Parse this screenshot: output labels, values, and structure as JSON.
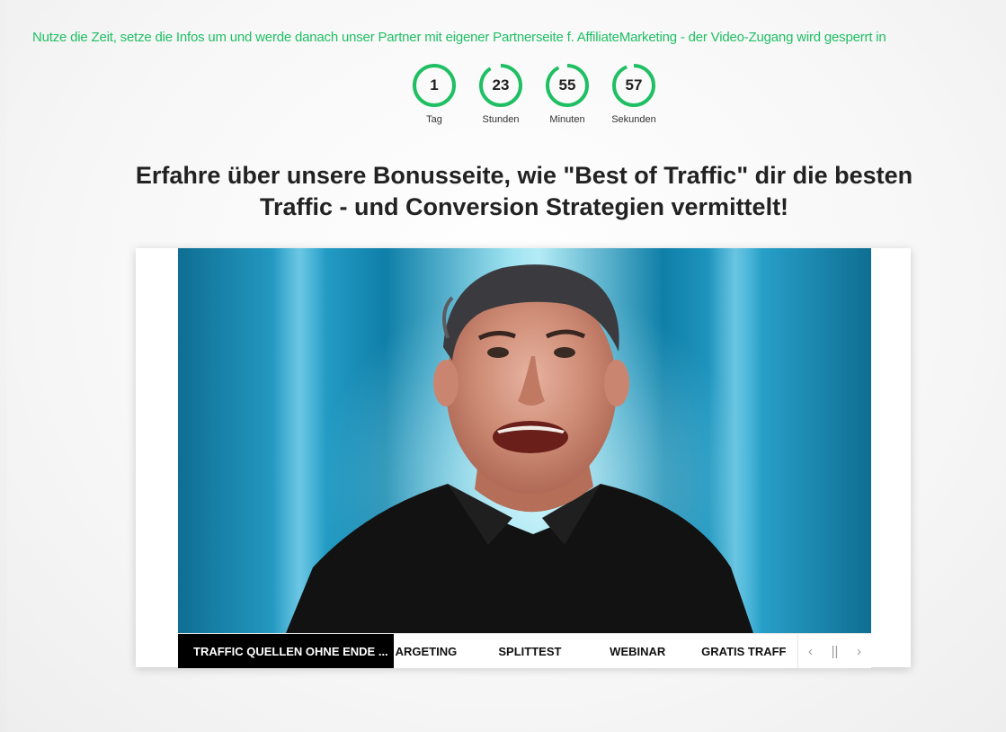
{
  "ticker": {
    "text": "Nutze die Zeit, setze die Infos um und werde danach unser Partner mit eigener Partnerseite f. AffiliateMarketing - der Video-Zugang wird gesperrt in"
  },
  "countdown": {
    "units": [
      {
        "value": "1",
        "label": "Tag"
      },
      {
        "value": "23",
        "label": "Stunden"
      },
      {
        "value": "55",
        "label": "Minuten"
      },
      {
        "value": "57",
        "label": "Sekunden"
      }
    ],
    "ring_color": "#1fbf63"
  },
  "headline": {
    "line1": "Erfahre über unsere Bonusseite, wie \"Best of Traffic\" dir die besten",
    "line2": "Traffic - und Conversion Strategien vermittelt!"
  },
  "player": {
    "tabs": [
      {
        "label": "TRAFFIC QUELLEN OHNE ENDE ...",
        "active": true
      },
      {
        "label": "ARGETING",
        "active": false
      },
      {
        "label": "SPLITTEST",
        "active": false
      },
      {
        "label": "WEBINAR",
        "active": false
      },
      {
        "label": "GRATIS TRAFF",
        "active": false
      }
    ],
    "controls": {
      "prev": "‹",
      "pause": "||",
      "next": "›"
    }
  }
}
